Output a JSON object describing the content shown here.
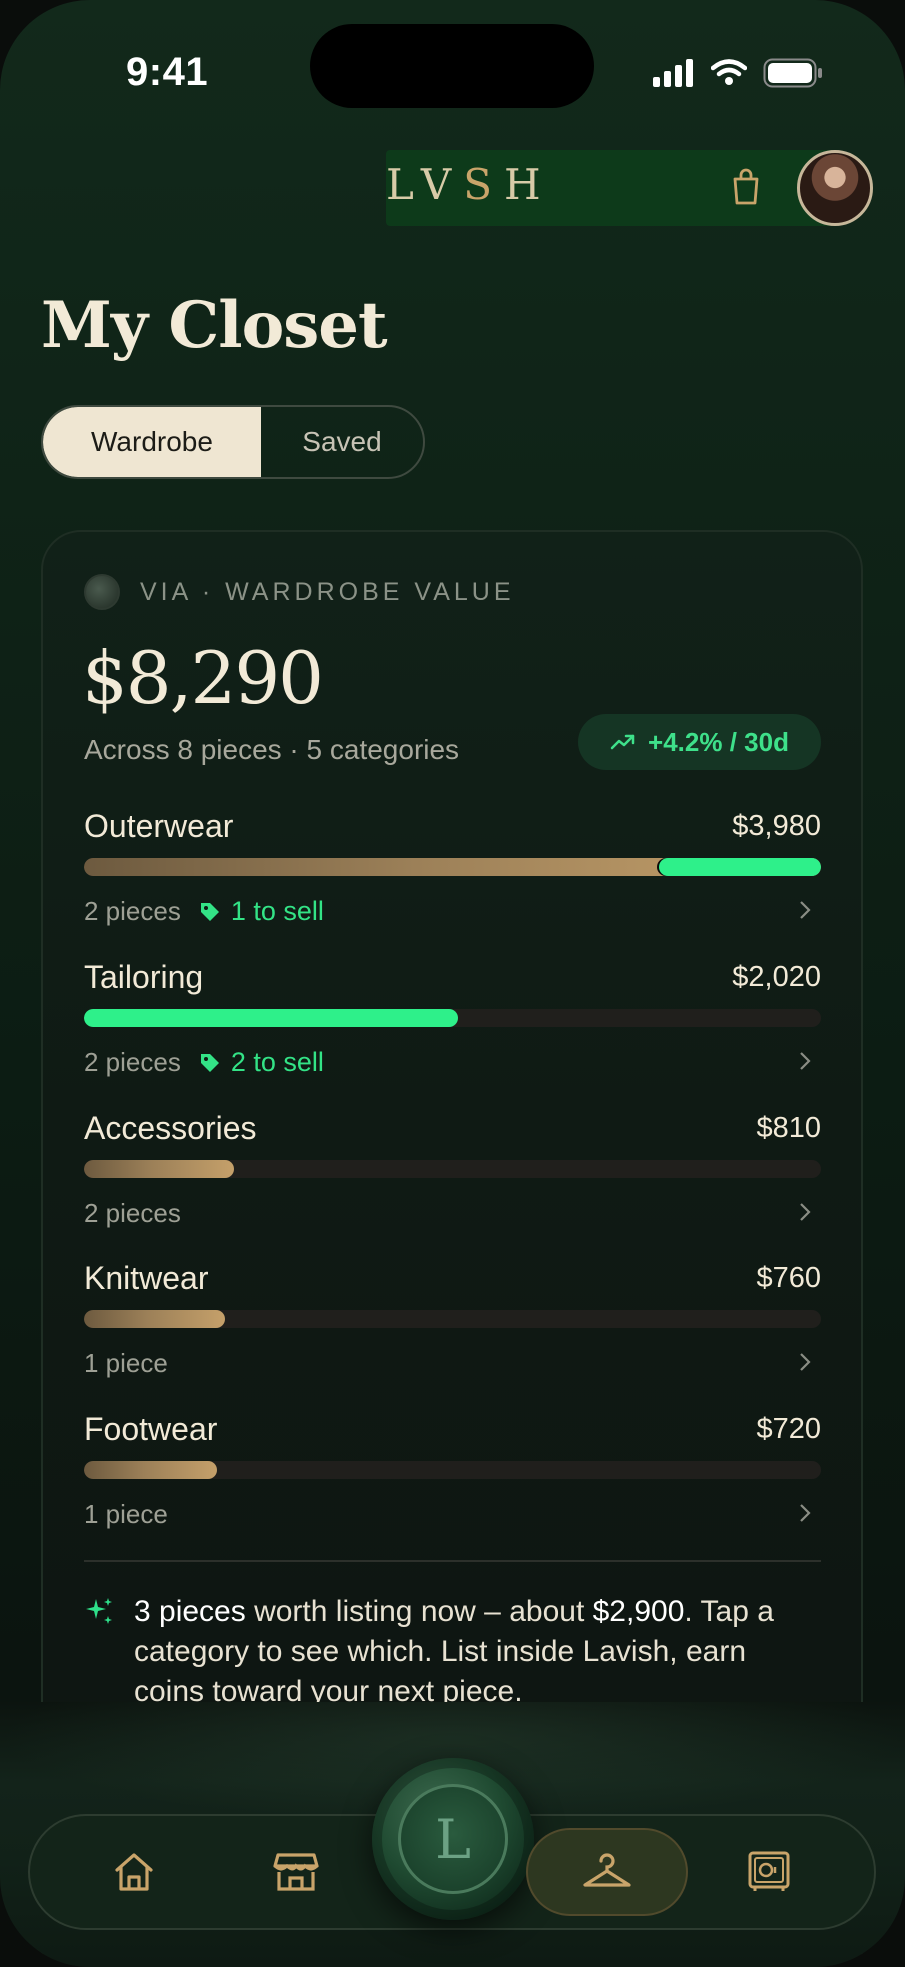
{
  "status": {
    "time": "9:41"
  },
  "header": {
    "brand_left": "LV",
    "brand_accent": "S",
    "brand_right": "H"
  },
  "page": {
    "title": "My Closet"
  },
  "segments": {
    "wardrobe": "Wardrobe",
    "saved": "Saved",
    "active": "wardrobe"
  },
  "summary": {
    "label": "VIA · WARDROBE VALUE",
    "total": "$8,290",
    "subtitle": "Across 8 pieces · 5 categories",
    "trend": "+4.2% / 30d"
  },
  "categories": [
    {
      "name": "Outerwear",
      "value": "$3,980",
      "pieces": "2 pieces",
      "sell": "1 to sell",
      "share": 1.0,
      "sell_share": 0.22,
      "style": "gold"
    },
    {
      "name": "Tailoring",
      "value": "$2,020",
      "pieces": "2 pieces",
      "sell": "2 to sell",
      "share": 0.507,
      "sell_share": 1.0,
      "style": "green"
    },
    {
      "name": "Accessories",
      "value": "$810",
      "pieces": "2 pieces",
      "sell": "",
      "share": 0.204,
      "sell_share": 0,
      "style": "gold"
    },
    {
      "name": "Knitwear",
      "value": "$760",
      "pieces": "1 piece",
      "sell": "",
      "share": 0.191,
      "sell_share": 0,
      "style": "gold"
    },
    {
      "name": "Footwear",
      "value": "$720",
      "pieces": "1 piece",
      "sell": "",
      "share": 0.181,
      "sell_share": 0,
      "style": "gold"
    }
  ],
  "insight": {
    "highlight_count": "3 pieces",
    "text_a": " worth listing now – about ",
    "highlight_amount": "$2,900",
    "text_b": ". Tap a category to see which. List inside Lavish, earn coins toward your next piece."
  },
  "nav": {
    "seal_letter": "L",
    "active_tab": "closet"
  },
  "colors": {
    "accent_green": "#2ef08a",
    "gold": "#c5a06a",
    "cream": "#efe6d2"
  }
}
